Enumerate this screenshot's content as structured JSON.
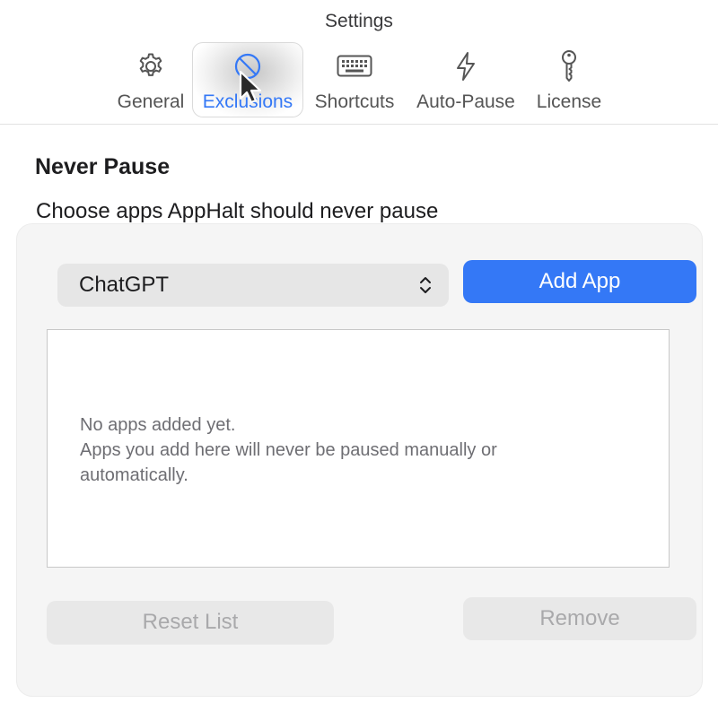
{
  "window": {
    "title": "Settings"
  },
  "toolbar": {
    "tabs": [
      {
        "label": "General",
        "icon": "gear-icon"
      },
      {
        "label": "Exclusions",
        "icon": "prohibited-icon",
        "active": true
      },
      {
        "label": "Shortcuts",
        "icon": "keyboard-icon"
      },
      {
        "label": "Auto-Pause",
        "icon": "bolt-icon"
      },
      {
        "label": "License",
        "icon": "key-icon"
      }
    ],
    "active_color": "#3478f6"
  },
  "section": {
    "title": "Never Pause",
    "subtitle": "Choose apps AppHalt should never pause"
  },
  "app_picker": {
    "selected": "ChatGPT"
  },
  "buttons": {
    "add": "Add App",
    "reset": "Reset List",
    "remove": "Remove"
  },
  "list": {
    "empty_line1": "No apps added yet.",
    "empty_line2": "Apps you add here will never be paused manually or automatically."
  }
}
